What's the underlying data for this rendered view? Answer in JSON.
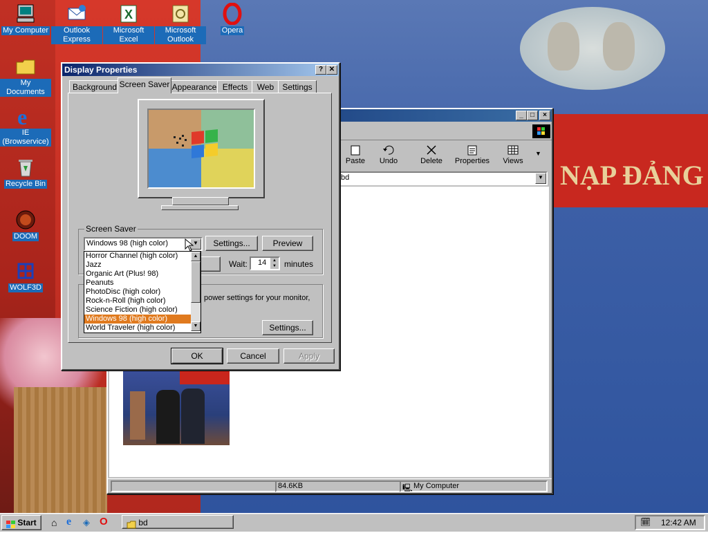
{
  "desktop_icons": [
    {
      "label": "My Computer",
      "icon": "computer-icon"
    },
    {
      "label": "Outlook Express",
      "icon": "outlook-express-icon"
    },
    {
      "label": "Microsoft Excel",
      "icon": "excel-icon"
    },
    {
      "label": "Microsoft Outlook",
      "icon": "outlook-icon"
    },
    {
      "label": "Opera",
      "icon": "opera-icon"
    },
    {
      "label": "My Documents",
      "icon": "folder-icon"
    },
    {
      "label": "IE (Browservice)",
      "icon": "internet-explorer-icon"
    },
    {
      "label": "Recycle Bin",
      "icon": "recycle-bin-icon"
    },
    {
      "label": "DOOM",
      "icon": "doom-icon"
    },
    {
      "label": "WOLF3D",
      "icon": "wolf3d-icon"
    }
  ],
  "wallpaper": {
    "banner_text": "NẠP ĐẢNG"
  },
  "explorer": {
    "toolbar": [
      "Paste",
      "Undo",
      "Delete",
      "Properties",
      "Views"
    ],
    "address_value": "\\bd",
    "status_size": "84.6KB",
    "status_zone": "My Computer"
  },
  "dialog": {
    "title": "Display Properties",
    "help_btn": "?",
    "close_btn": "✕",
    "tabs": [
      "Background",
      "Screen Saver",
      "Appearance",
      "Effects",
      "Web",
      "Settings"
    ],
    "active_tab": "Screen Saver",
    "screensaver_group": "Screen Saver",
    "selected_saver": "Windows 98 (high color)",
    "settings_btn": "Settings...",
    "preview_btn": "Preview",
    "wait_label": "Wait:",
    "wait_value": "14",
    "wait_unit": "minutes",
    "power_text": "power settings for your monitor,",
    "power_settings_btn": "Settings...",
    "ok": "OK",
    "cancel": "Cancel",
    "apply": "Apply",
    "dropdown_items": [
      "Horror Channel (high color)",
      "Jazz",
      "Organic Art (Plus! 98)",
      "Peanuts",
      "PhotoDisc (high color)",
      "Rock-n-Roll (high color)",
      "Science Fiction (high color)",
      "Windows 98 (high color)",
      "World Traveler (high color)"
    ],
    "dropdown_selected_index": 7
  },
  "taskbar": {
    "start": "Start",
    "task_label": "bd",
    "clock": "12:42 AM"
  },
  "colors": {
    "selection": "#e07a1e",
    "titlebar": "#0a246a",
    "desktop_label_bg": "#1c6bb8"
  }
}
